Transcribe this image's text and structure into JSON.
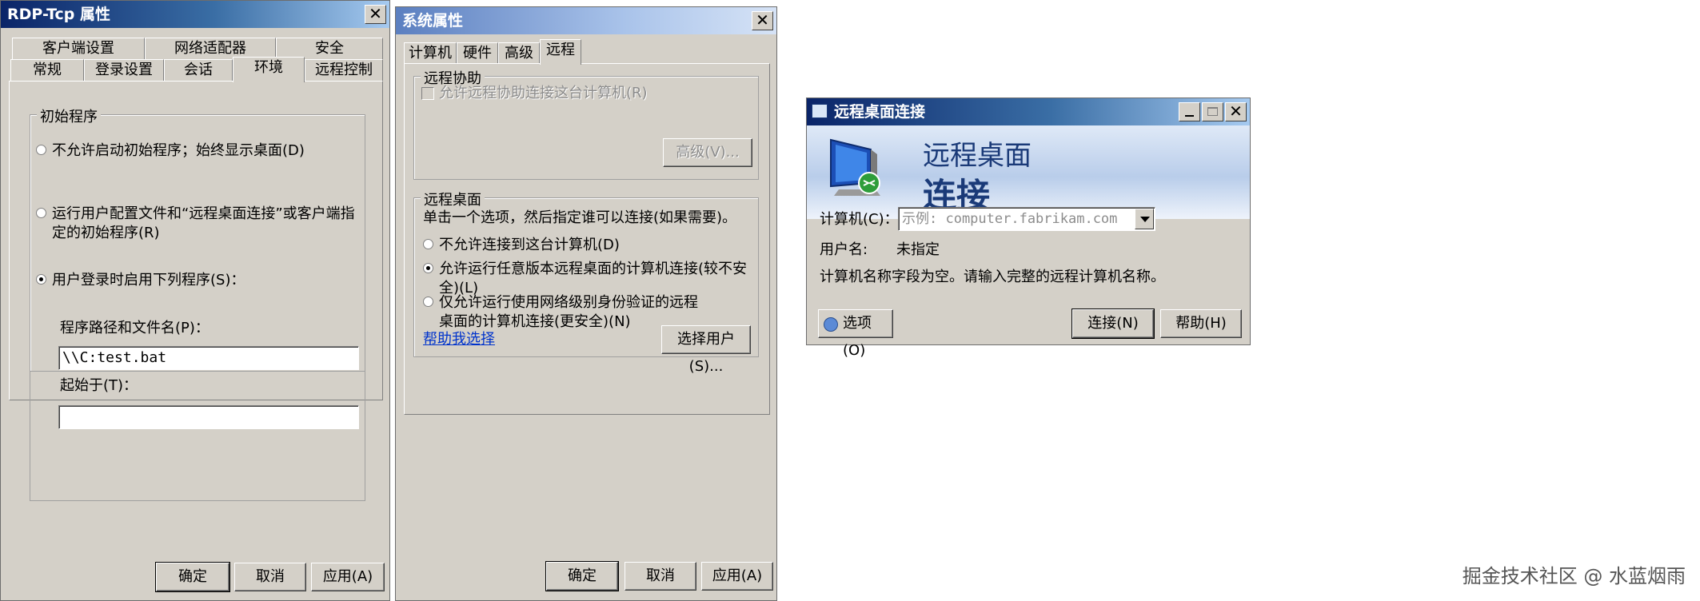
{
  "rdp_tcp": {
    "title": "RDP-Tcp 属性",
    "tabs_top": [
      "客户端设置",
      "网络适配器",
      "安全"
    ],
    "tabs_bottom": [
      "常规",
      "登录设置",
      "会话",
      "环境",
      "远程控制"
    ],
    "active_tab": "环境",
    "group_label": "初始程序",
    "options": [
      "不允许启动初始程序；始终显示桌面(D)",
      "运行用户配置文件和“远程桌面连接”或客户端指定的初始程序(R)",
      "用户登录时启用下列程序(S)："
    ],
    "selected_option": 2,
    "path_label": "程序路径和文件名(P)：",
    "path_value": "\\\\C:test.bat",
    "start_label": "起始于(T)：",
    "start_value": "",
    "buttons": {
      "ok": "确定",
      "cancel": "取消",
      "apply": "应用(A)"
    }
  },
  "sysprops": {
    "title": "系统属性",
    "tabs": [
      "计算机名",
      "硬件",
      "高级",
      "远程"
    ],
    "active_tab": "远程",
    "assist_group": "远程协助",
    "assist_checkbox": "允许远程协助连接这台计算机(R)",
    "advanced_button": "高级(V)...",
    "desktop_group": "远程桌面",
    "desktop_hint": "单击一个选项，然后指定谁可以连接(如果需要)。",
    "options": [
      "不允许连接到这台计算机(D)",
      "允许运行任意版本远程桌面的计算机连接(较不安全)(L)",
      "仅允许运行使用网络级别身份验证的远程桌面的计算机连接(更安全)(N)"
    ],
    "selected_option": 1,
    "help_link": "帮助我选择",
    "select_users_button": "选择用户(S)...",
    "buttons": {
      "ok": "确定",
      "cancel": "取消",
      "apply": "应用(A)"
    }
  },
  "rdc": {
    "title": "远程桌面连接",
    "banner_line1": "远程桌面",
    "banner_line2": "连接",
    "computer_label": "计算机(C)：",
    "computer_placeholder": "示例: computer.fabrikam.com",
    "user_label": "用户名:",
    "user_value": "未指定",
    "message": "计算机名称字段为空。请输入完整的远程计算机名称。",
    "options_button": "选项(O)",
    "connect_button": "连接(N)",
    "help_button": "帮助(H)"
  },
  "watermark": "掘金技术社区 @ 水蓝烟雨"
}
